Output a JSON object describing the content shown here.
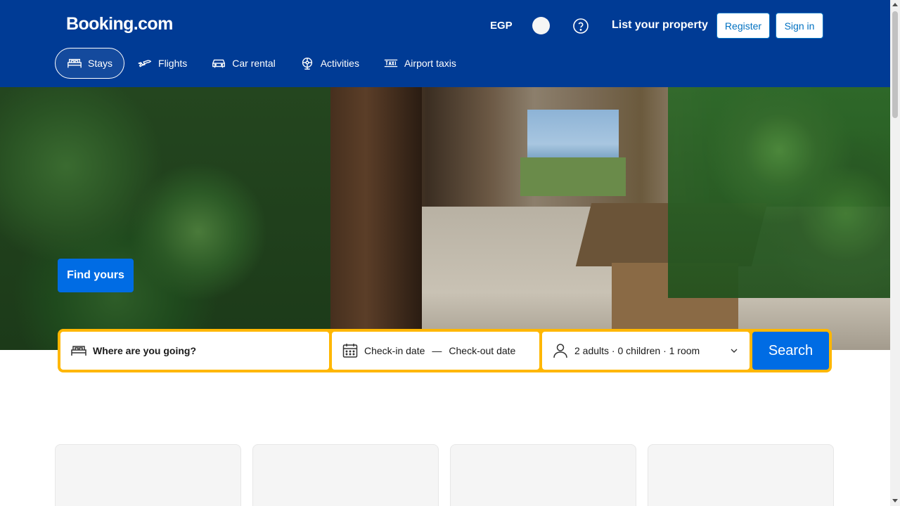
{
  "header": {
    "logo": "Booking.com",
    "currency": "EGP",
    "help_icon": "question-circle-icon",
    "list_property": "List your property",
    "register_label": "Register",
    "signin_label": "Sign in",
    "bg_color": "#003b95"
  },
  "nav": {
    "items": [
      {
        "label": "Stays",
        "icon": "bed-icon",
        "active": true
      },
      {
        "label": "Flights",
        "icon": "plane-icon",
        "active": false
      },
      {
        "label": "Car rental",
        "icon": "car-icon",
        "active": false
      },
      {
        "label": "Activities",
        "icon": "attractions-icon",
        "active": false
      },
      {
        "label": "Airport taxis",
        "icon": "taxi-icon",
        "active": false
      }
    ]
  },
  "hero": {
    "cta_label": "Find yours"
  },
  "search": {
    "destination_placeholder": "Where are you going?",
    "checkin": "Check-in date",
    "dash": "—",
    "checkout": "Check-out date",
    "guests": "2 adults · 0 children · 1 room",
    "button_label": "Search",
    "border_color": "#ffb700",
    "button_color": "#006ce4"
  }
}
